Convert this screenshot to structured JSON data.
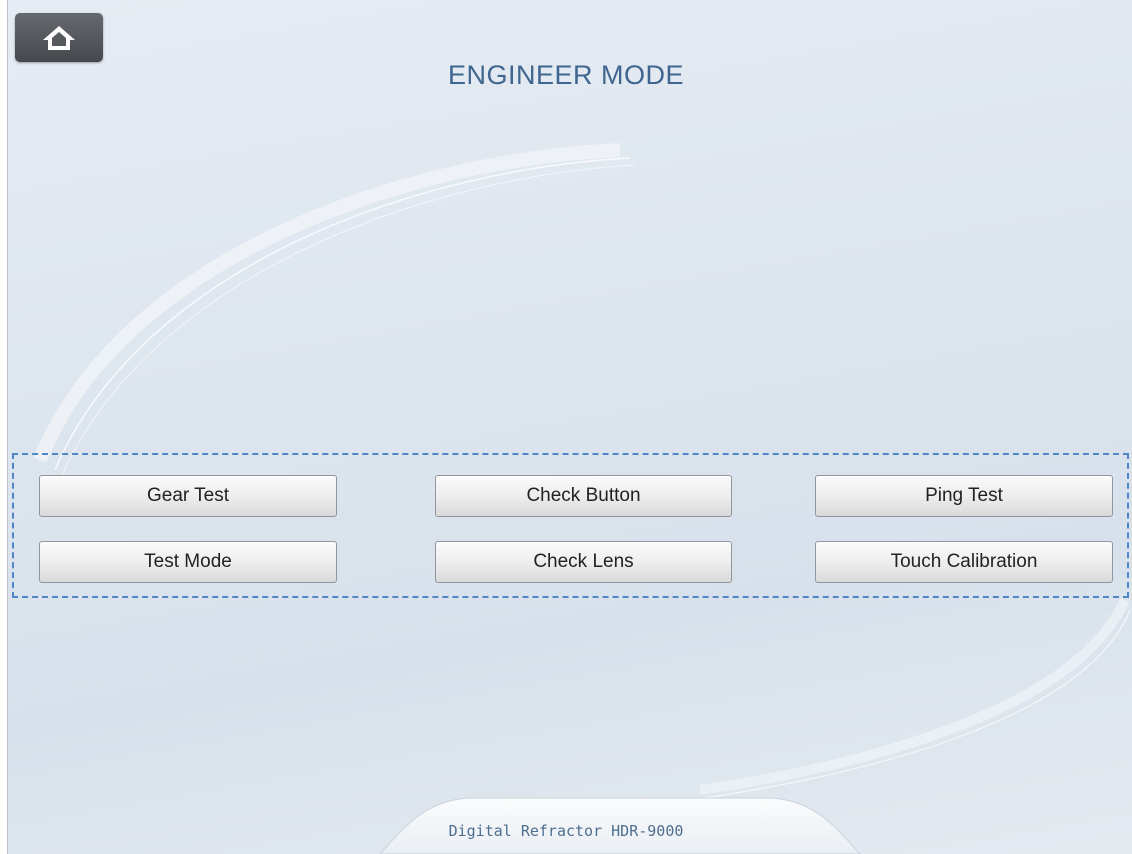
{
  "header": {
    "title": "ENGINEER MODE",
    "home_icon": "home-icon"
  },
  "buttons": [
    {
      "label": "Gear Test"
    },
    {
      "label": "Check Button"
    },
    {
      "label": "Ping Test"
    },
    {
      "label": "Test Mode"
    },
    {
      "label": "Check Lens"
    },
    {
      "label": "Touch Calibration"
    }
  ],
  "footer": {
    "label": "Digital Refractor HDR-9000"
  },
  "colors": {
    "title": "#3f6690",
    "dashed_border": "#4f86c9",
    "home_button": "#55585d"
  }
}
